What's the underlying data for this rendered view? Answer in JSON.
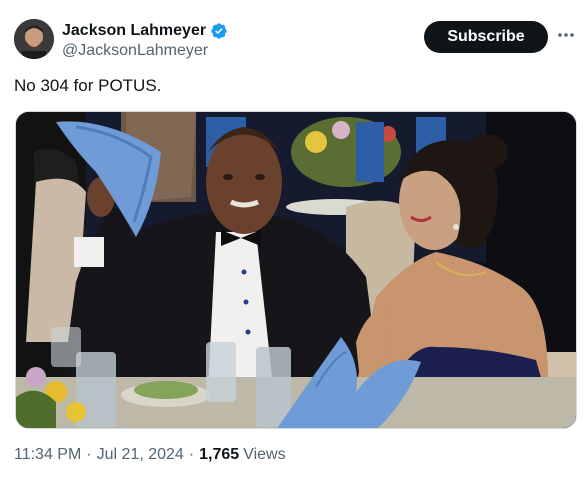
{
  "author": {
    "display_name": "Jackson Lahmeyer",
    "handle": "@JacksonLahmeyer",
    "verified": true,
    "verified_icon": "verified-badge-icon"
  },
  "actions": {
    "subscribe_label": "Subscribe",
    "more_icon": "more-options-icon"
  },
  "tweet": {
    "text": "No 304 for POTUS."
  },
  "meta": {
    "time": "11:34 PM",
    "date": "Jul 21, 2024",
    "views_count": "1,765",
    "views_label": "Views"
  },
  "colors": {
    "text": "#0f1419",
    "secondary": "#536471",
    "verified": "#1d9bf0",
    "button_bg": "#0f1419"
  }
}
